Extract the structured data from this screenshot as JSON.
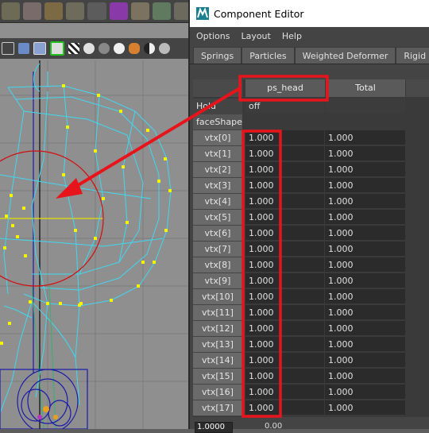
{
  "window": {
    "title": "Component Editor",
    "icon": "maya-icon"
  },
  "menu": [
    "Options",
    "Layout",
    "Help"
  ],
  "tabs": [
    {
      "label": "Springs",
      "active": false
    },
    {
      "label": "Particles",
      "active": false
    },
    {
      "label": "Weighted Deformer",
      "active": false
    },
    {
      "label": "Rigid Skins",
      "active": false
    }
  ],
  "grid": {
    "columns": [
      "ps_head",
      "Total"
    ],
    "hold_row": {
      "label": "Hold",
      "value": "off"
    },
    "shape_row": {
      "label": "faceShape"
    },
    "rows": [
      {
        "label": "vtx[0]",
        "ps_head": "1.000",
        "total": "1.000"
      },
      {
        "label": "vtx[1]",
        "ps_head": "1.000",
        "total": "1.000"
      },
      {
        "label": "vtx[2]",
        "ps_head": "1.000",
        "total": "1.000"
      },
      {
        "label": "vtx[3]",
        "ps_head": "1.000",
        "total": "1.000"
      },
      {
        "label": "vtx[4]",
        "ps_head": "1.000",
        "total": "1.000"
      },
      {
        "label": "vtx[5]",
        "ps_head": "1.000",
        "total": "1.000"
      },
      {
        "label": "vtx[6]",
        "ps_head": "1.000",
        "total": "1.000"
      },
      {
        "label": "vtx[7]",
        "ps_head": "1.000",
        "total": "1.000"
      },
      {
        "label": "vtx[8]",
        "ps_head": "1.000",
        "total": "1.000"
      },
      {
        "label": "vtx[9]",
        "ps_head": "1.000",
        "total": "1.000"
      },
      {
        "label": "vtx[10]",
        "ps_head": "1.000",
        "total": "1.000"
      },
      {
        "label": "vtx[11]",
        "ps_head": "1.000",
        "total": "1.000"
      },
      {
        "label": "vtx[12]",
        "ps_head": "1.000",
        "total": "1.000"
      },
      {
        "label": "vtx[13]",
        "ps_head": "1.000",
        "total": "1.000"
      },
      {
        "label": "vtx[14]",
        "ps_head": "1.000",
        "total": "1.000"
      },
      {
        "label": "vtx[15]",
        "ps_head": "1.000",
        "total": "1.000"
      },
      {
        "label": "vtx[16]",
        "ps_head": "1.000",
        "total": "1.000"
      },
      {
        "label": "vtx[17]",
        "ps_head": "1.000",
        "total": "1.000"
      }
    ]
  },
  "bottom": {
    "input_value": "1.0000",
    "slider_value": "0.00"
  },
  "colors": {
    "annotation": "#e8141c",
    "wireframe": "#40d8f0",
    "vertex": "#f5f500",
    "joint": "#1a1aa8"
  }
}
